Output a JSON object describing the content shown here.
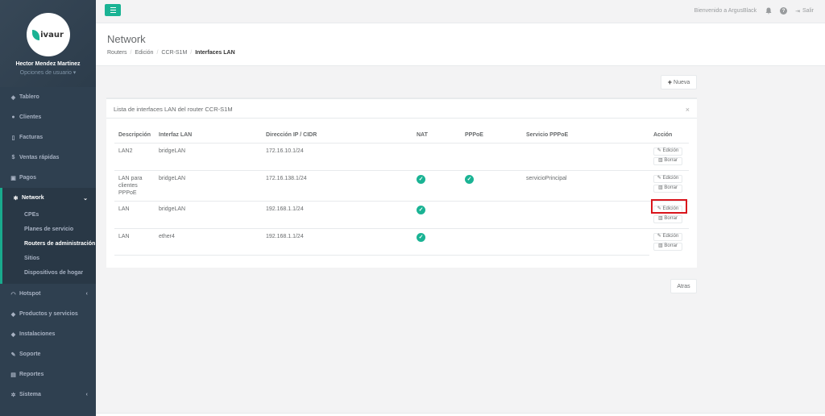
{
  "sidebar": {
    "logo_text": "ivaur",
    "user_name": "Hector Mendez Martinez",
    "user_options": "Opciones de usuario ▾",
    "items": [
      {
        "label": "Tablero",
        "icon": "dashboard-icon"
      },
      {
        "label": "Clientes",
        "icon": "users-icon"
      },
      {
        "label": "Facturas",
        "icon": "file-icon"
      },
      {
        "label": "Ventas rápidas",
        "icon": "dollar-icon"
      },
      {
        "label": "Pagos",
        "icon": "money-icon"
      },
      {
        "label": "Network",
        "icon": "snowflake-icon",
        "active": true
      },
      {
        "label": "Hotspot",
        "icon": "wifi-icon"
      },
      {
        "label": "Productos y servicios",
        "icon": "tag-icon"
      },
      {
        "label": "Instalaciones",
        "icon": "tool-icon"
      },
      {
        "label": "Soporte",
        "icon": "wrench-icon"
      },
      {
        "label": "Reportes",
        "icon": "book-icon"
      },
      {
        "label": "Sistema",
        "icon": "gears-icon"
      }
    ],
    "network_submenu": [
      "CPEs",
      "Planes de servicio",
      "Routers de administración",
      "Sitios",
      "Dispositivos de hogar"
    ]
  },
  "topbar": {
    "welcome": "Bienvenido a ArgusBlack",
    "logout": "Salir"
  },
  "heading": {
    "title": "Network",
    "breadcrumb": [
      "Routers",
      "Edición",
      "CCR-S1M",
      "Interfaces LAN"
    ]
  },
  "buttons": {
    "nueva": "Nueva",
    "atras": "Atras",
    "edit": "Edición",
    "delete": "Borrar"
  },
  "panel": {
    "title": "Lista de interfaces LAN del router CCR-S1M",
    "close": "×",
    "columns": [
      "Descripción",
      "Interfaz LAN",
      "Dirección IP / CIDR",
      "NAT",
      "PPPoE",
      "Servicio PPPoE",
      "Acción"
    ],
    "rows": [
      {
        "descripcion": "LAN2",
        "interfaz": "bridgeLAN",
        "ip": "172.16.10.1/24",
        "nat": false,
        "pppoe": false,
        "servicio": ""
      },
      {
        "descripcion": "LAN para clientes PPPoE",
        "interfaz": "bridgeLAN",
        "ip": "172.16.138.1/24",
        "nat": true,
        "pppoe": true,
        "servicio": "servicioPrincipal"
      },
      {
        "descripcion": "LAN",
        "interfaz": "bridgeLAN",
        "ip": "192.168.1.1/24",
        "nat": true,
        "pppoe": false,
        "servicio": ""
      },
      {
        "descripcion": "LAN",
        "interfaz": "ether4",
        "ip": "192.168.1.1/24",
        "nat": true,
        "pppoe": false,
        "servicio": ""
      }
    ]
  },
  "colors": {
    "sidebar_bg": "#2f4050",
    "accent": "#1ab394",
    "highlight": "#d9151c"
  }
}
